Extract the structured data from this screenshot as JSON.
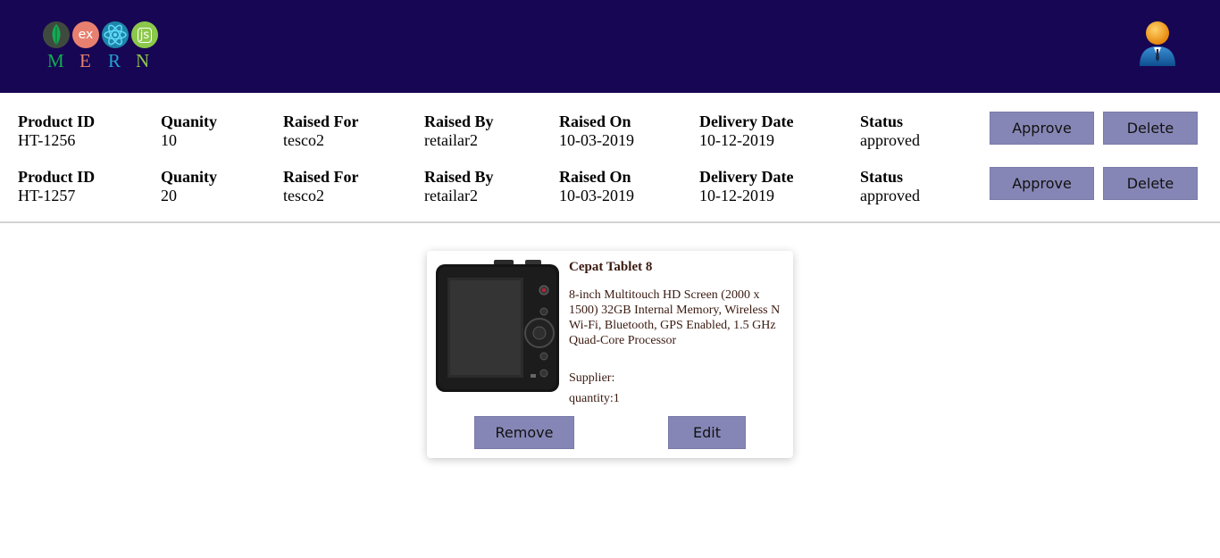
{
  "header": {
    "logo_letters": [
      "M",
      "E",
      "R",
      "N"
    ],
    "logo_ex": "ex",
    "logo_js": "js",
    "colors": {
      "background": "#170653",
      "m": "#13aa52",
      "e": "#e8806f",
      "r": "#1fa3d1",
      "n": "#8cc84b"
    }
  },
  "orders": [
    {
      "product_id_label": "Product ID",
      "product_id": "HT-1256",
      "quantity_label": "Quanity",
      "quantity": "10",
      "raised_for_label": "Raised For",
      "raised_for": "tesco2",
      "raised_by_label": "Raised By",
      "raised_by": "retailar2",
      "raised_on_label": "Raised On",
      "raised_on": "10-03-2019",
      "delivery_label": "Delivery Date",
      "delivery": "10-12-2019",
      "status_label": "Status",
      "status": "approved",
      "approve_label": "Approve",
      "delete_label": "Delete"
    },
    {
      "product_id_label": "Product ID",
      "product_id": "HT-1257",
      "quantity_label": "Quanity",
      "quantity": "20",
      "raised_for_label": "Raised For",
      "raised_for": "tesco2",
      "raised_by_label": "Raised By",
      "raised_by": "retailar2",
      "raised_on_label": "Raised On",
      "raised_on": "10-03-2019",
      "delivery_label": "Delivery Date",
      "delivery": "10-12-2019",
      "status_label": "Status",
      "status": "approved",
      "approve_label": "Approve",
      "delete_label": "Delete"
    }
  ],
  "product": {
    "title": "Cepat Tablet 8",
    "description": "8-inch Multitouch HD Screen (2000 x 1500) 32GB Internal Memory, Wireless N Wi-Fi, Bluetooth, GPS Enabled, 1.5 GHz Quad-Core Processor",
    "supplier": "Supplier:",
    "quantity": "quantity:1",
    "image_icon": "camera-image",
    "remove_label": "Remove",
    "edit_label": "Edit"
  },
  "colors": {
    "button": "#8686b6",
    "divider": "#d3d3d3",
    "card_text": "#3a1a10"
  }
}
